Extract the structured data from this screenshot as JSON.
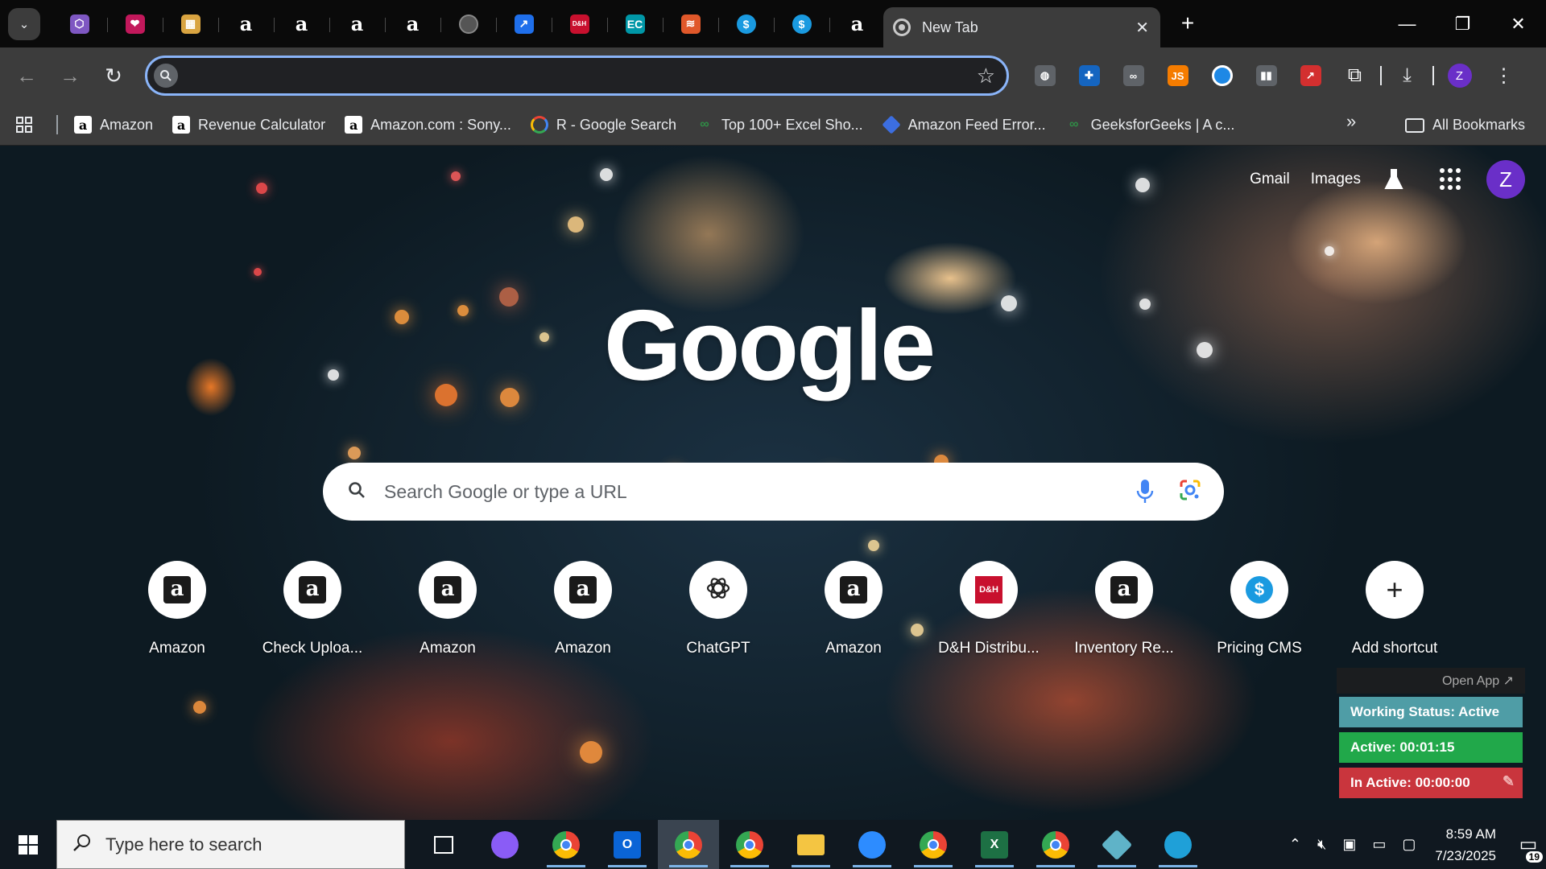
{
  "browser": {
    "pinned_tabs": [
      {
        "icon": "cube-icon",
        "glyph": "⬡",
        "color": "#7e57c2"
      },
      {
        "icon": "heart-icon",
        "glyph": "❤",
        "color": "#c2185b"
      },
      {
        "icon": "box-icon",
        "glyph": "▦",
        "color": "#d9a441"
      },
      {
        "icon": "amazon-icon",
        "glyph": "a",
        "color": "transparent"
      },
      {
        "icon": "amazon-icon",
        "glyph": "a",
        "color": "transparent"
      },
      {
        "icon": "amazon-icon",
        "glyph": "a",
        "color": "transparent"
      },
      {
        "icon": "amazon-icon",
        "glyph": "a",
        "color": "transparent"
      },
      {
        "icon": "globe-icon",
        "glyph": "",
        "color": "#555555"
      },
      {
        "icon": "share-icon",
        "glyph": "↗",
        "color": "#1f6feb"
      },
      {
        "icon": "dh-icon",
        "glyph": "D&H",
        "color": "#c8102e"
      },
      {
        "icon": "ec-icon",
        "glyph": "EC",
        "color": "#0097a7"
      },
      {
        "icon": "layers-icon",
        "glyph": "≋",
        "color": "#e0582a"
      },
      {
        "icon": "dollar-icon",
        "glyph": "$",
        "color": "#1a9ae0"
      },
      {
        "icon": "dollar-icon",
        "glyph": "$",
        "color": "#1a9ae0"
      },
      {
        "icon": "amazon-icon",
        "glyph": "a",
        "color": "transparent"
      }
    ],
    "active_tab": {
      "title": "New Tab",
      "close": "✕"
    },
    "new_tab": "+",
    "window_controls": {
      "minimize": "—",
      "restore": "❐",
      "close": "✕"
    },
    "omnibox": {
      "value": "",
      "placeholder": ""
    },
    "extensions": [
      {
        "icon": "globe-ext-icon",
        "glyph": "◍",
        "color": "#5f6368"
      },
      {
        "icon": "puzzle-blue-icon",
        "glyph": "✚",
        "color": "#1565c0"
      },
      {
        "icon": "link-icon",
        "glyph": "∞",
        "color": "#5f6368"
      },
      {
        "icon": "js-icon",
        "glyph": "JS",
        "color": "#f57c00"
      },
      {
        "icon": "circle-icon",
        "glyph": "",
        "color": "#1e88e5"
      },
      {
        "icon": "bars-icon",
        "glyph": "▮▮",
        "color": "#5f6368"
      },
      {
        "icon": "arrow-red-icon",
        "glyph": "↗",
        "color": "#d32f2f"
      },
      {
        "icon": "extensions-icon",
        "glyph": "⧉",
        "color": "transparent"
      }
    ],
    "profile_initial": "Z"
  },
  "bookmarks": [
    {
      "label": "Amazon",
      "icon": "amazon-icon"
    },
    {
      "label": "Revenue Calculator",
      "icon": "amazon-icon"
    },
    {
      "label": "Amazon.com : Sony...",
      "icon": "amazon-icon"
    },
    {
      "label": "R - Google Search",
      "icon": "google-icon"
    },
    {
      "label": "Top 100+ Excel Sho...",
      "icon": "gfg-icon"
    },
    {
      "label": "Amazon Feed Error...",
      "icon": "diamond-icon"
    },
    {
      "label": "GeeksforGeeks | A c...",
      "icon": "gfg-icon"
    }
  ],
  "bookmarks_more": "»",
  "all_bookmarks": "All Bookmarks",
  "ntp": {
    "links": {
      "gmail": "Gmail",
      "images": "Images"
    },
    "logo": "Google",
    "profile_initial": "Z",
    "search_placeholder": "Search Google or type a URL",
    "shortcuts": [
      {
        "label": "Amazon",
        "icon": "amazon-icon"
      },
      {
        "label": "Check Uploa...",
        "icon": "amazon-icon"
      },
      {
        "label": "Amazon",
        "icon": "amazon-icon"
      },
      {
        "label": "Amazon",
        "icon": "amazon-icon"
      },
      {
        "label": "ChatGPT",
        "icon": "chatgpt-icon"
      },
      {
        "label": "Amazon",
        "icon": "amazon-icon"
      },
      {
        "label": "D&H Distribu...",
        "icon": "dh-icon"
      },
      {
        "label": "Inventory Re...",
        "icon": "amazon-icon"
      },
      {
        "label": "Pricing CMS",
        "icon": "dollar-icon"
      },
      {
        "label": "Add shortcut",
        "icon": "plus-icon"
      }
    ]
  },
  "widget": {
    "open_app": "Open App ↗",
    "status": "Working Status: Active",
    "active": "Active: 00:01:15",
    "inactive": "In Active: 00:00:00"
  },
  "taskbar": {
    "search_placeholder": "Type here to search",
    "apps": [
      {
        "icon": "task-view-icon",
        "color": "transparent"
      },
      {
        "icon": "copilot-icon",
        "color": "#8a5cf6"
      },
      {
        "icon": "chrome-profile-icon",
        "color": "#34a853"
      },
      {
        "icon": "outlook-icon",
        "color": "#0a64d6"
      },
      {
        "icon": "chrome-z-icon",
        "color": "#ea4335"
      },
      {
        "icon": "chrome-profile-2-icon",
        "color": "#34a853"
      },
      {
        "icon": "file-explorer-icon",
        "color": "#f4c542"
      },
      {
        "icon": "zoom-icon",
        "color": "#2d8cff"
      },
      {
        "icon": "chrome-icon",
        "color": "#fbbc05"
      },
      {
        "icon": "excel-icon",
        "color": "#1d7044"
      },
      {
        "icon": "chrome-profile-3-icon",
        "color": "#34a853"
      },
      {
        "icon": "app-diamond-icon",
        "color": "#5fb3c8"
      },
      {
        "icon": "edge-icon",
        "color": "#1fa0d8"
      }
    ],
    "time": "8:59 AM",
    "date": "7/23/2025",
    "notifications": "19"
  }
}
